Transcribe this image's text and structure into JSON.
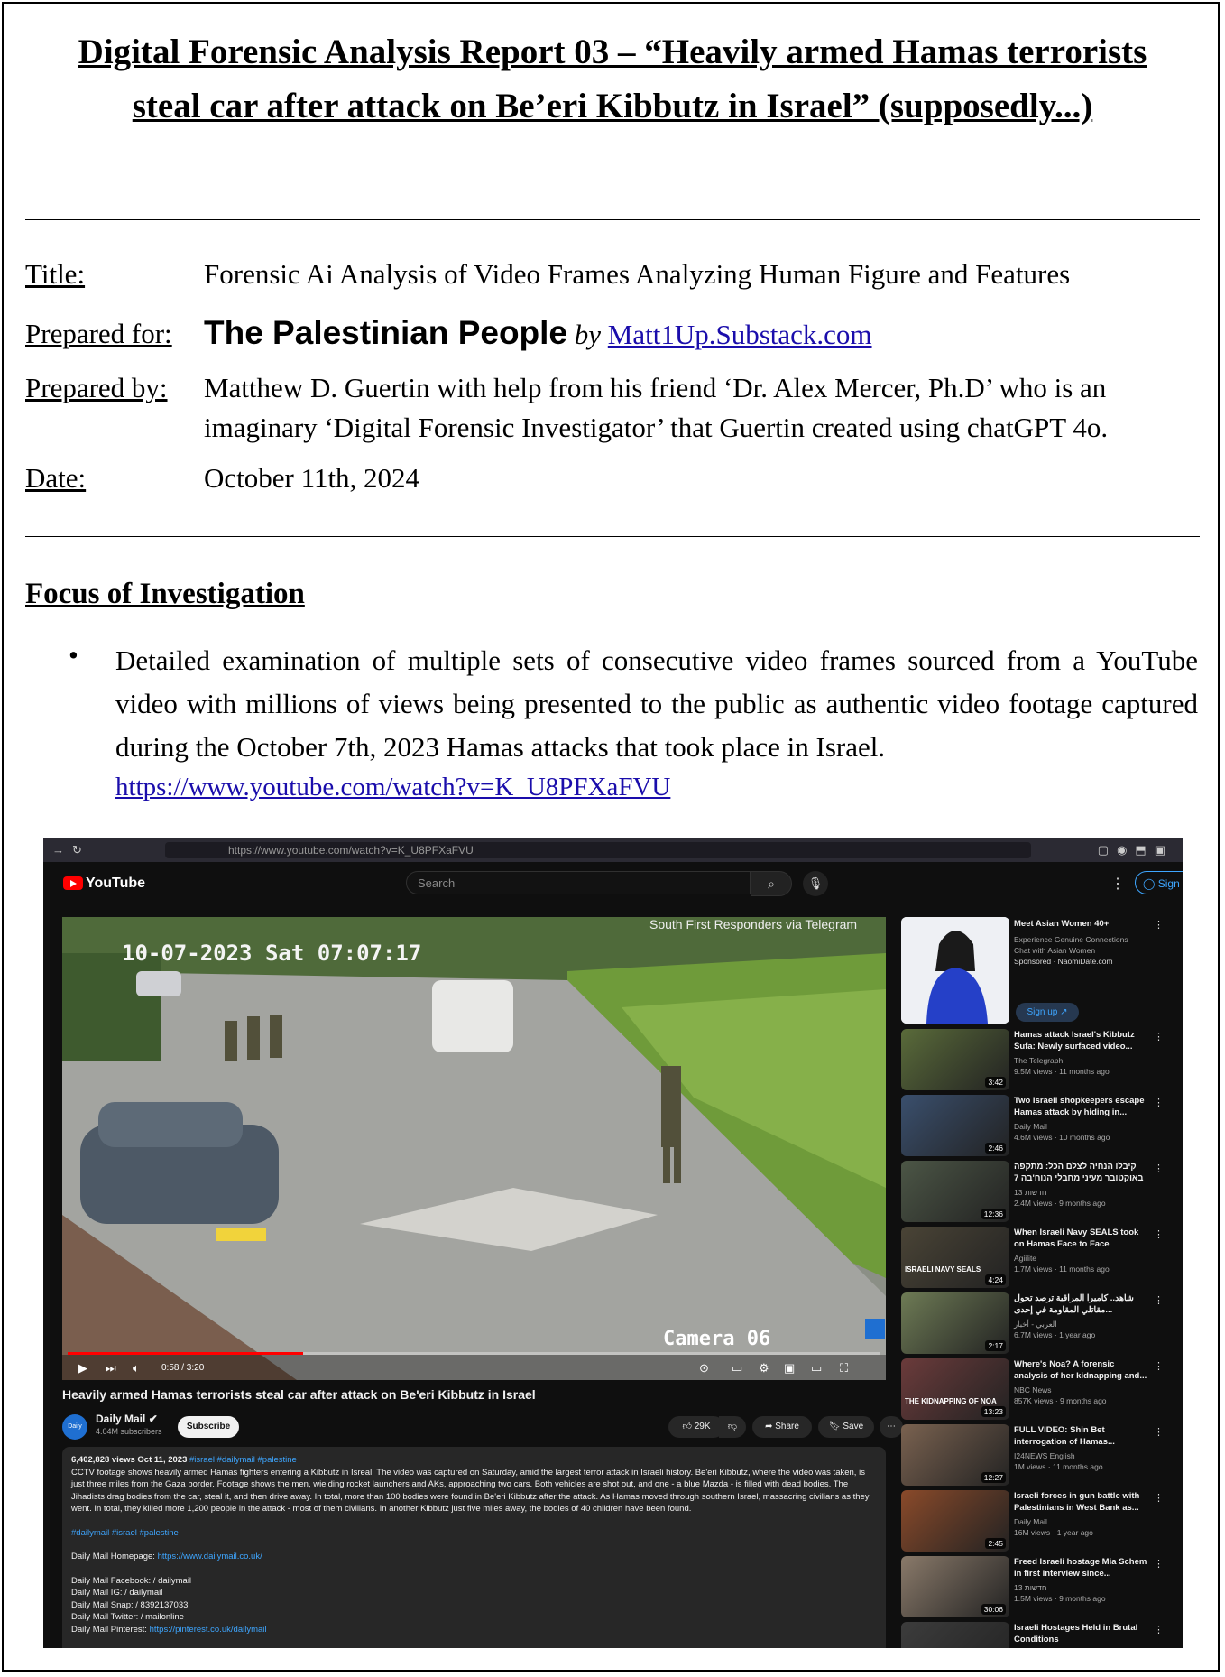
{
  "report": {
    "title": "Digital Forensic Analysis Report 03 – “Heavily armed Hamas terrorists steal car after attack on Be’eri Kibbutz in Israel” (supposedly...)",
    "title_label": "Title:",
    "title_value": "Forensic Ai Analysis of Video Frames Analyzing Human Figure and Features",
    "prepared_for_label": "Prepared for:",
    "prepared_for_value": "The Palestinian People",
    "prepared_for_by": "by",
    "prepared_for_link": "Matt1Up.Substack.com",
    "prepared_by_label": "Prepared by:",
    "prepared_by_line1": "Matthew D. Guertin with help from his friend ‘Dr. Alex Mercer, Ph.D’ who is an",
    "prepared_by_line2": "imaginary ‘Digital Forensic Investigator’ that Guertin created using chatGPT 4o.",
    "date_label": "Date:",
    "date_value": "October 11th, 2024",
    "focus_heading": "Focus of Investigation",
    "focus_bullet": "Detailed examination of multiple sets of consecutive video frames sourced from a YouTube video with millions of views being presented to the public as authentic video footage captured during the October 7th, 2023 Hamas attacks that took place in Israel.",
    "focus_url": "https://www.youtube.com/watch?v=K_U8PFXaFVU"
  },
  "screenshot": {
    "browser_url": "https://www.youtube.com/watch?v=K_U8PFXaFVU",
    "yt_logo": "YouTube",
    "search_placeholder": "Search",
    "sign_in": "Sign in",
    "video": {
      "timestamp_overlay": "10-07-2023 Sat 07:07:17",
      "source_overlay": "South First Responders via Telegram",
      "camera_overlay": "Camera 06",
      "time": "0:58 / 3:20",
      "progress": 0.29
    },
    "video_title": "Heavily armed Hamas terrorists steal car after attack on Be'eri Kibbutz in Israel",
    "channel": {
      "name": "Daily Mail",
      "subs": "4.04M subscribers",
      "avatar_text": "Daily Mail",
      "subscribe": "Subscribe"
    },
    "actions": {
      "likes": "29K",
      "share": "Share",
      "save": "Save"
    },
    "description": {
      "stats": "6,402,828 views  Oct 11, 2023",
      "tags": "#israel #dailymail #palestine",
      "body": "CCTV footage shows heavily armed Hamas fighters entering a Kibbutz in Isreal. The video was captured on Saturday, amid the largest terror attack in Israeli history. Be'eri Kibbutz, where the video was taken, is just three miles from the Gaza border. Footage shows the men, wielding rocket launchers and AKs, approaching two cars. Both vehicles are shot out, and one - a blue Mazda - is filled with dead bodies. The Jihadists drag bodies from the car, steal it, and then drive away. In total, more than 100 bodies were found in Be'eri Kibbutz after the attack. As Hamas moved through southern Israel, massacring civilians as they went. In total, they killed more 1,200 people in the attack - most of them civilians. In another Kibbutz just five miles away, the bodies of 40 children have been found.",
      "tags2": "#dailymail #israel #palestine",
      "homepage_label": "Daily Mail Homepage:",
      "homepage_url": "https://www.dailymail.co.uk/",
      "facebook": "Daily Mail Facebook:  / dailymail",
      "ig": "Daily Mail IG:  / dailymail",
      "snap": "Daily Mail Snap:  / 8392137033",
      "twitter": "Daily Mail Twitter:  / mailonline",
      "pinterest_label": "Daily Mail Pinterest:",
      "pinterest_url": "https://pinterest.co.uk/dailymail"
    },
    "ad": {
      "title": "Meet Asian Women 40+",
      "line1": "Experience Genuine Connections",
      "line2": "Chat with Asian Women",
      "sponsor": "Sponsored · NaomiDate.com",
      "cta": "Sign up"
    },
    "sidebar": [
      {
        "title": "Hamas attack Israel's Kibbutz Sufa: Newly surfaced video...",
        "channel": "The Telegraph",
        "stats": "9.5M views · 11 months ago",
        "dur": "3:42",
        "color": "#5a6b3a"
      },
      {
        "title": "Two Israeli shopkeepers escape Hamas attack by hiding in...",
        "channel": "Daily Mail",
        "stats": "4.6M views · 10 months ago",
        "dur": "2:46",
        "color": "#3a4f6d"
      },
      {
        "title": "קיבלו הנחיה לצלם הכל: מתקפה באוקטובר מעיני מחבלי הנוח'בה 7",
        "channel": "13 חדשות",
        "stats": "2.4M views · 9 months ago",
        "dur": "12:36",
        "color": "#4c5646"
      },
      {
        "title": "When Israeli Navy SEALS took on Hamas Face to Face",
        "channel": "Agiilite",
        "stats": "1.7M views · 11 months ago",
        "dur": "4:24",
        "color": "#4a4436",
        "thumb_text": "ISRAELI NAVY SEALS"
      },
      {
        "title": "شاهد.. كاميرا المراقبة ترصد تجول مقاتلي المقاومة في إحدى...",
        "channel": "العربي - أخبار",
        "stats": "6.7M views · 1 year ago",
        "dur": "2:17",
        "color": "#6e7b55"
      },
      {
        "title": "Where's Noa? A forensic analysis of her kidnapping and...",
        "channel": "NBC News",
        "stats": "857K views · 9 months ago",
        "dur": "13:23",
        "color": "#6b3b3b",
        "thumb_text": "THE KIDNAPPING OF NOA"
      },
      {
        "title": "FULL VIDEO: Shin Bet interrogation of Hamas...",
        "channel": "I24NEWS English",
        "stats": "1M views · 11 months ago",
        "dur": "12:27",
        "color": "#7a6250"
      },
      {
        "title": "Israeli forces in gun battle with Palestinians in West Bank as...",
        "channel": "Daily Mail",
        "stats": "16M views · 1 year ago",
        "dur": "2:45",
        "color": "#8a4a2a"
      },
      {
        "title": "Freed Israeli hostage Mia Schem in first interview since...",
        "channel": "13 חדשות",
        "stats": "1.5M views · 9 months ago",
        "dur": "30:06",
        "color": "#8a7a6a"
      },
      {
        "title": "Israeli Hostages Held in Brutal Conditions",
        "channel": "",
        "stats": "",
        "dur": "",
        "color": "#3c3c3c"
      }
    ]
  }
}
